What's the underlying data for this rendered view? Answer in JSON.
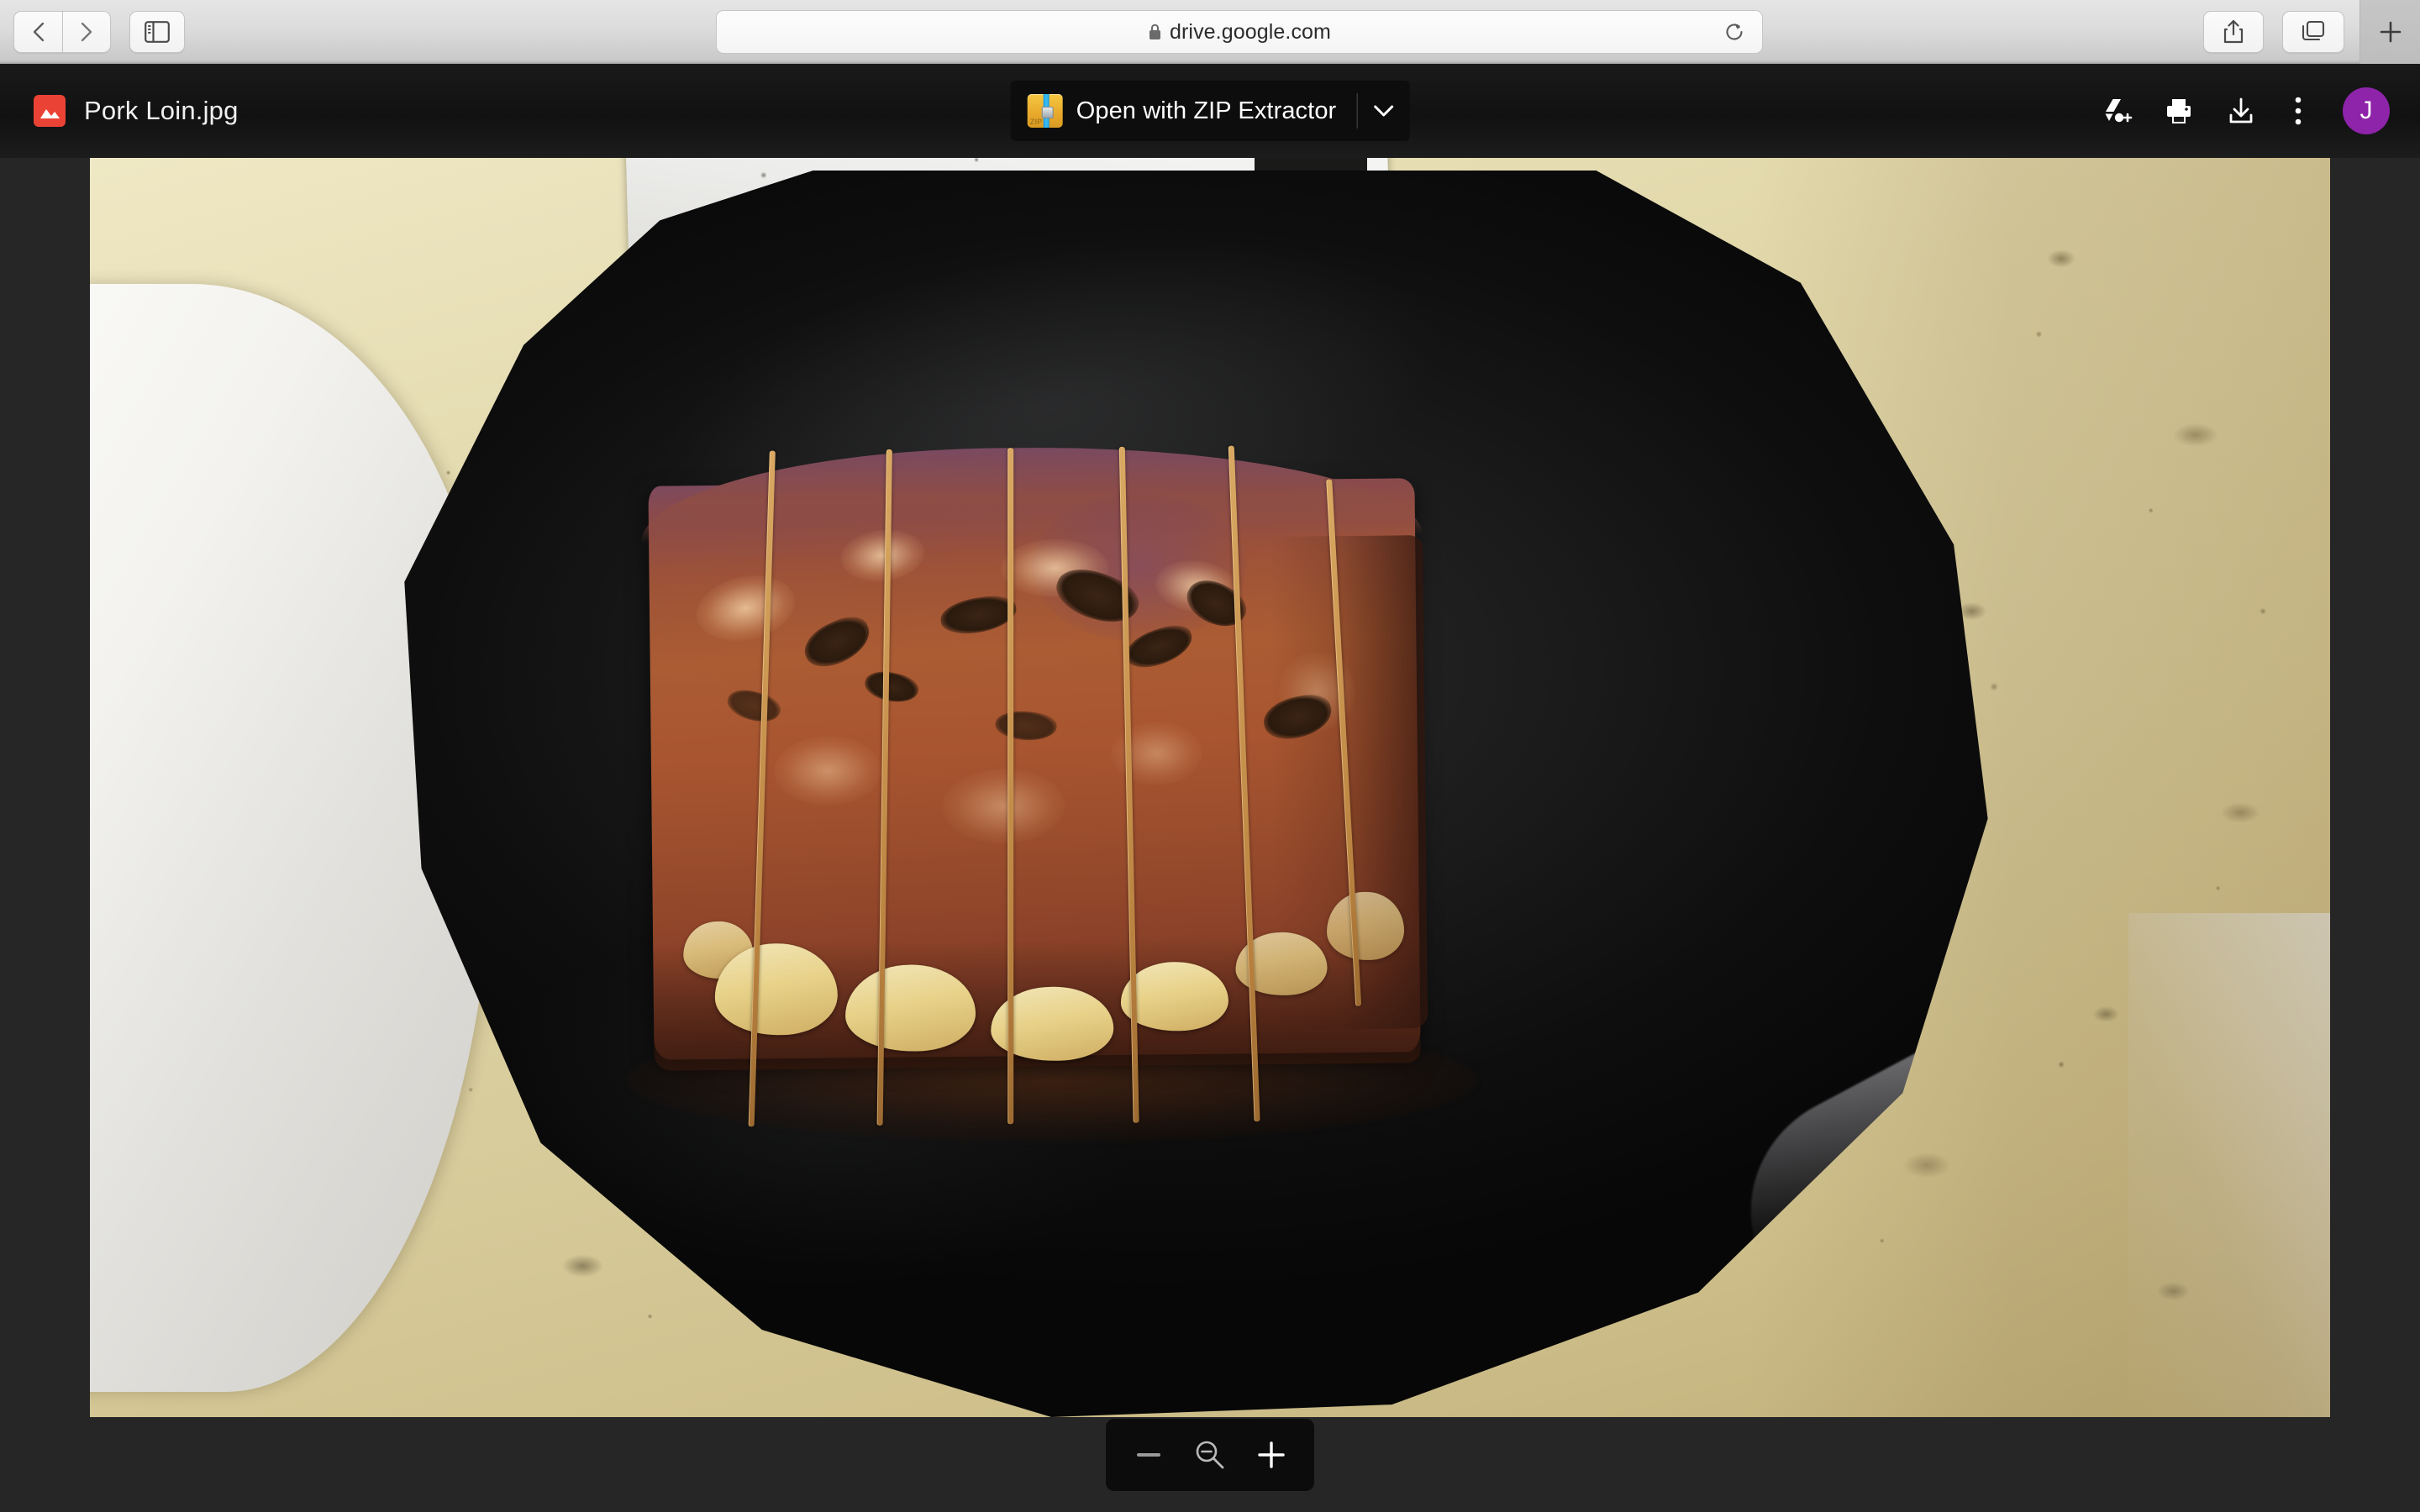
{
  "browser": {
    "back_label": "Back",
    "forward_label": "Forward",
    "sidebar_label": "Show Sidebar",
    "url": "drive.google.com",
    "lock_icon": "lock-icon",
    "reload_label": "Reload",
    "share_label": "Share",
    "tab_overview_label": "Tab Overview",
    "new_tab_label": "+"
  },
  "drive": {
    "file_name": "Pork Loin.jpg",
    "file_icon": "image-file-icon",
    "open_with": {
      "label": "Open with ZIP Extractor",
      "app_icon": "zip-folder-icon",
      "zip_icon_text": "ZIP",
      "caret_icon": "chevron-down-icon"
    },
    "actions": [
      {
        "name": "add-to-drive",
        "label": "Add to My Drive"
      },
      {
        "name": "print",
        "label": "Print"
      },
      {
        "name": "download",
        "label": "Download"
      },
      {
        "name": "more-options",
        "label": "More actions"
      }
    ],
    "account": {
      "initial": "J",
      "color": "#8e24aa"
    }
  },
  "viewer": {
    "image_alt": "Tied and seared pork loin roast resting on a black cast-iron pan on a beige speckled granite countertop, with a white plate and a metal spatula nearby",
    "background_color": "#262626",
    "zoom_controls": {
      "zoom_out_label": "Zoom out",
      "zoom_reset_label": "Reset zoom",
      "zoom_in_label": "Zoom in",
      "minus_glyph": "−",
      "plus_glyph": "+",
      "magnifier_icon": "magnifier-minus-icon"
    }
  }
}
